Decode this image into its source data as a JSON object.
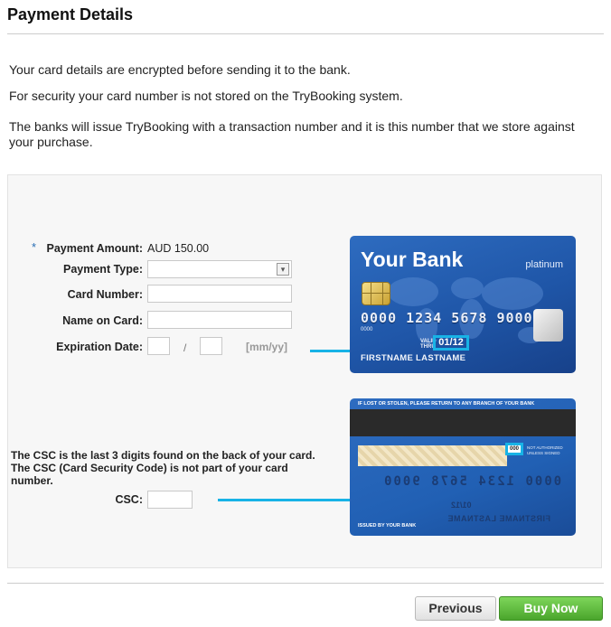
{
  "page": {
    "title": "Payment Details"
  },
  "info": {
    "line1": "Your card details are encrypted before sending it to the bank.",
    "line2": "For security your card number is not stored on the TryBooking system.",
    "line3": "The banks will issue TryBooking with a transaction number and it is this number that we store against your purchase."
  },
  "form": {
    "required_marker": "*",
    "payment_amount_label": "Payment Amount:",
    "payment_amount_value": "AUD 150.00",
    "payment_type_label": "Payment Type:",
    "payment_type_value": "",
    "card_number_label": "Card Number:",
    "card_number_value": "",
    "name_on_card_label": "Name on Card:",
    "name_on_card_value": "",
    "expiration_label": "Expiration Date:",
    "expiration_month": "",
    "expiration_separator": "/",
    "expiration_year": "",
    "expiration_format": "[mm/yy]",
    "csc_note": "The CSC is the last 3 digits found on the back of your card. The CSC (Card Security Code) is not part of your card number.",
    "csc_label": "CSC:",
    "csc_value": ""
  },
  "card_front": {
    "bank_name": "Your Bank",
    "tier": "platinum",
    "number": "0000 1234 5678 9000",
    "small_digits": "0000",
    "valid_label": "VALID THRU",
    "expiry": "01/12",
    "holder": "FIRSTNAME LASTNAME"
  },
  "card_back": {
    "lost_text": "IF LOST OR STOLEN, PLEASE RETURN TO ANY BRANCH OF YOUR BANK",
    "cvv": "000",
    "auth_text": "NOT AUTHORIZED UNLESS SIGNED",
    "mirror_number": "0000 1234 5678 9000",
    "mirror_expiry": "01/12",
    "mirror_name": "FIRSTNAME LASTNAME",
    "issued_text": "ISSUED BY YOUR BANK"
  },
  "buttons": {
    "previous": "Previous",
    "buy_now": "Buy Now"
  },
  "colors": {
    "accent": "#18b3e6",
    "buy_button": "#4aa52c",
    "card_blue": "#2160b4"
  }
}
